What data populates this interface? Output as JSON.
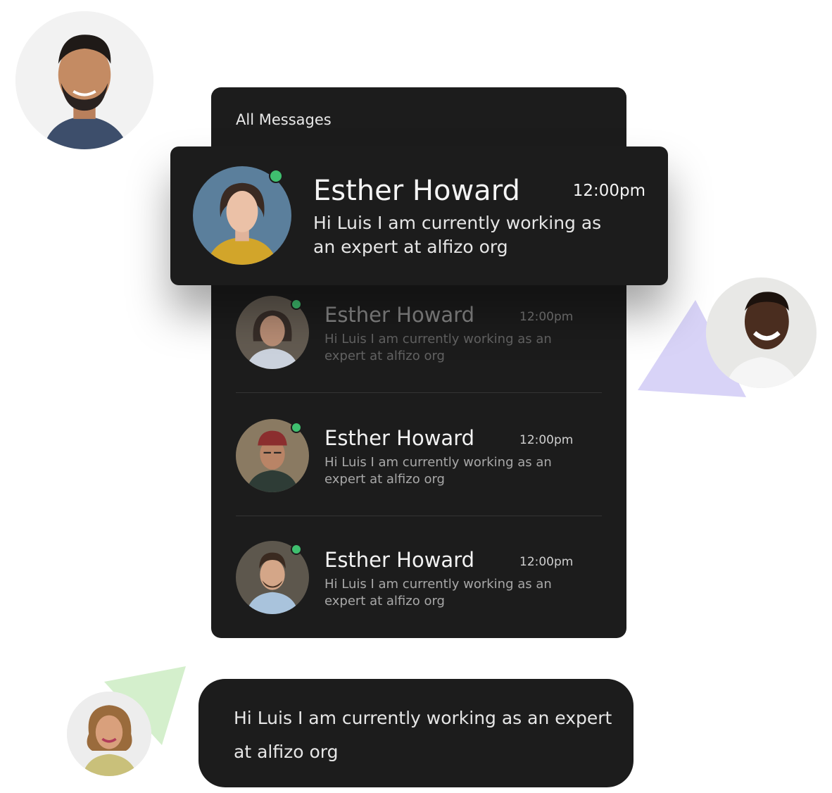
{
  "panel": {
    "title": "All Messages"
  },
  "featured": {
    "name": "Esther Howard",
    "time": "12:00pm",
    "message": "Hi Luis I am currently working as an expert at alfizo org",
    "online": true
  },
  "messages": [
    {
      "name": "Esther Howard",
      "time": "12:00pm",
      "message": "Hi Luis I am currently working as an expert at alfizo org",
      "online": true
    },
    {
      "name": "Esther Howard",
      "time": "12:00pm",
      "message": "Hi Luis I am currently working as an expert at alfizo org",
      "online": true
    },
    {
      "name": "Esther Howard",
      "time": "12:00pm",
      "message": "Hi Luis I am currently working as an expert at alfizo org",
      "online": true
    }
  ],
  "bubble": {
    "text": "Hi Luis I am currently working as an expert at alfizo org"
  },
  "colors": {
    "panel_bg": "#1c1c1c",
    "online_dot": "#3fbf6f",
    "triangle_purple": "#d8d3f7",
    "triangle_green": "#d4efcc"
  }
}
